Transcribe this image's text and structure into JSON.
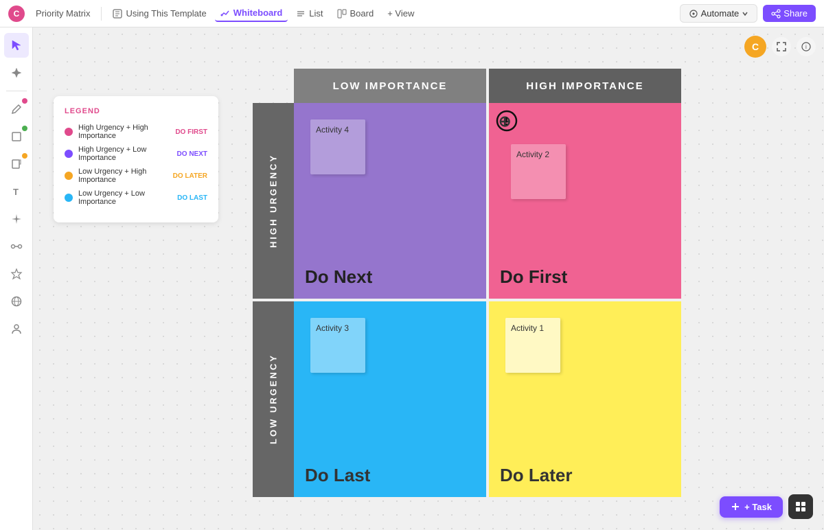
{
  "nav": {
    "logo": "C",
    "title": "Priority Matrix",
    "tabs": [
      {
        "id": "using-template",
        "label": "Using This Template",
        "active": false
      },
      {
        "id": "whiteboard",
        "label": "Whiteboard",
        "active": true
      },
      {
        "id": "list",
        "label": "List",
        "active": false
      },
      {
        "id": "board",
        "label": "Board",
        "active": false
      },
      {
        "id": "view",
        "label": "+ View",
        "active": false
      }
    ],
    "automate_label": "Automate",
    "share_label": "Share",
    "user_initial": "C"
  },
  "legend": {
    "title": "LEGEND",
    "items": [
      {
        "color": "#e04a8c",
        "label": "High Urgency + High Importance",
        "tag": "DO FIRST",
        "tag_class": "tag-first"
      },
      {
        "color": "#7c4dff",
        "label": "High Urgency + Low Importance",
        "tag": "DO NEXT",
        "tag_class": "tag-next"
      },
      {
        "color": "#f5a623",
        "label": "Low Urgency + High Importance",
        "tag": "DO LATER",
        "tag_class": "tag-later"
      },
      {
        "color": "#29b6f6",
        "label": "Low Urgency + Low Importance",
        "tag": "DO LAST",
        "tag_class": "tag-last"
      }
    ]
  },
  "matrix": {
    "col_headers": [
      {
        "id": "low",
        "label": "LOW IMPORTANCE"
      },
      {
        "id": "high",
        "label": "HIGH IMPORTANCE"
      }
    ],
    "row_labels": [
      {
        "id": "high-urgency",
        "label": "HIGH URGENCY"
      },
      {
        "id": "low-urgency",
        "label": "LOW URGENCY"
      }
    ],
    "quadrants": [
      {
        "id": "do-next",
        "label": "Do Next",
        "bg": "#9575cd",
        "activity": "Activity 4"
      },
      {
        "id": "do-first",
        "label": "Do First",
        "bg": "#f06292",
        "activity": "Activity 2"
      },
      {
        "id": "do-last",
        "label": "Do Last",
        "bg": "#29b6f6",
        "activity": "Activity 3"
      },
      {
        "id": "do-later",
        "label": "Do Later",
        "bg": "#ffee58",
        "activity": "Activity 1"
      }
    ]
  },
  "toolbar": {
    "add_task_label": "+ Task"
  },
  "icons": {
    "cursor": "↖",
    "ai": "✦",
    "pen": "✏",
    "rect": "□",
    "note": "📝",
    "text": "T",
    "sparkle": "✦",
    "connect": "⬡",
    "star": "★",
    "globe": "⊕",
    "person": "👤",
    "list": "≡",
    "board": "⊞",
    "expand": "↔",
    "info": "ⓘ"
  }
}
